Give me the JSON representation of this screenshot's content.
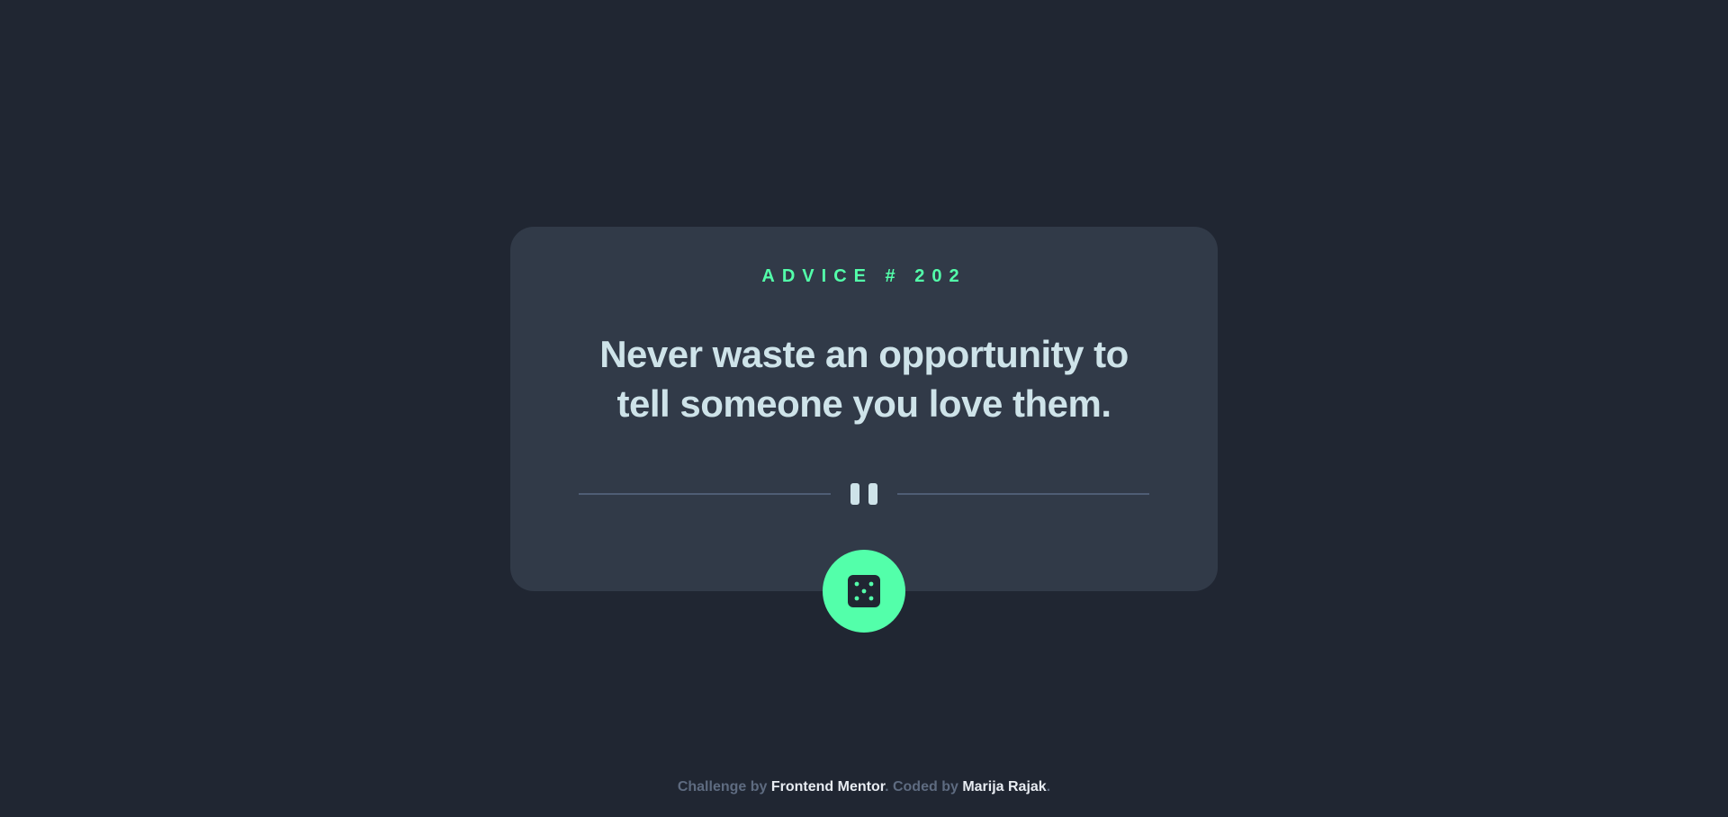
{
  "advice": {
    "id_label": "ADVICE # 202",
    "text": "Never waste an opportunity to tell someone you love them."
  },
  "divider": {
    "icon": "pause-icon"
  },
  "dice_button": {
    "icon": "dice-icon"
  },
  "footer": {
    "prefix": "Challenge by ",
    "challenge_link": "Frontend Mentor",
    "middle": ". Coded by ",
    "author_link": "Marija Rajak",
    "suffix": "."
  },
  "colors": {
    "background": "#202632",
    "card": "#313a48",
    "accent": "#53ffaa",
    "text": "#cee3e9",
    "divider": "#4f5d74",
    "footer_muted": "#5e6b80"
  }
}
